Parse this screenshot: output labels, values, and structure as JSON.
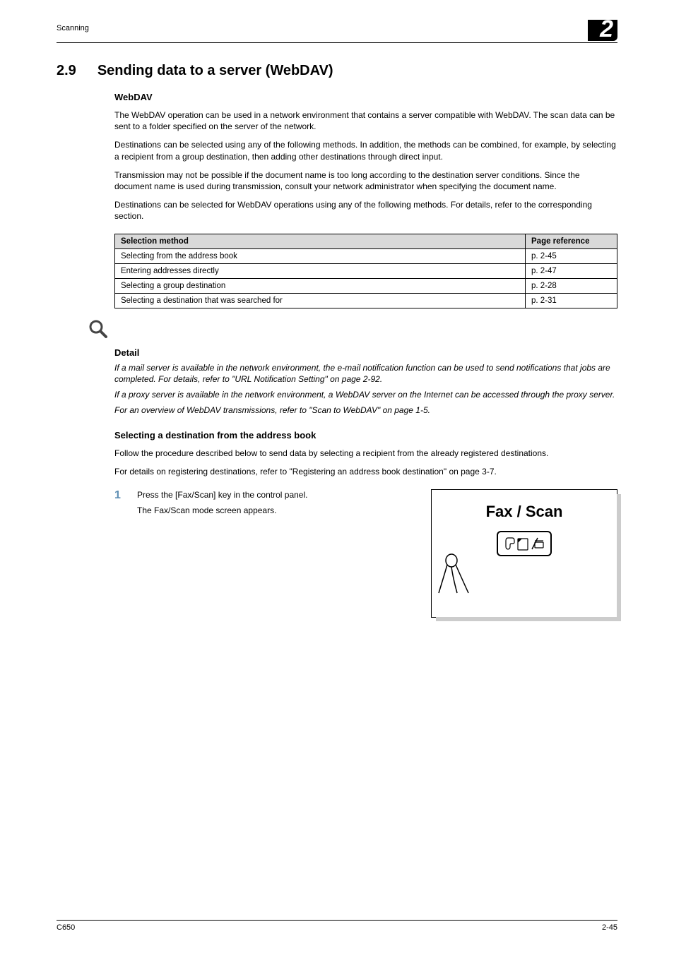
{
  "header": {
    "running_head": "Scanning",
    "chapter_number": "2"
  },
  "section": {
    "number": "2.9",
    "title": "Sending data to a server (WebDAV)"
  },
  "subheading_webdav": "WebDAV",
  "para1": "The WebDAV operation can be used in a network environment that contains a server compatible with WebDAV. The scan data can be sent to a folder specified on the server of the network.",
  "para2": "Destinations can be selected using any of the following methods. In addition, the methods can be combined, for example, by selecting a recipient from a group destination, then adding other destinations through direct input.",
  "para3": "Transmission may not be possible if the document name is too long according to the destination server conditions. Since the document name is used during transmission, consult your network administrator when specifying the document name.",
  "para4": "Destinations can be selected for WebDAV operations using any of the following methods. For details, refer to the corresponding section.",
  "table": {
    "headers": {
      "method": "Selection method",
      "reference": "Page reference"
    },
    "rows": [
      {
        "method": "Selecting from the address book",
        "reference": "p. 2-45"
      },
      {
        "method": "Entering addresses directly",
        "reference": "p. 2-47"
      },
      {
        "method": "Selecting a group destination",
        "reference": "p. 2-28"
      },
      {
        "method": "Selecting a destination that was searched for",
        "reference": "p. 2-31"
      }
    ]
  },
  "detail": {
    "label": "Detail",
    "p1": "If a mail server is available in the network environment, the e-mail notification function can be used to send notifications that jobs are completed. For details, refer to \"URL Notification Setting\" on page 2-92.",
    "p2": "If a proxy server is available in the network environment, a WebDAV server on the Internet can be accessed through the proxy server.",
    "p3": "For an overview of WebDAV transmissions, refer to \"Scan to WebDAV\" on page 1-5."
  },
  "subheading_select": "Selecting a destination from the address book",
  "select_p1": "Follow the procedure described below to send data by selecting a recipient from the already registered destinations.",
  "select_p2": "For details on registering destinations, refer to \"Registering an address book destination\" on page 3-7.",
  "step1": {
    "num": "1",
    "line1": "Press the [Fax/Scan] key in the control panel.",
    "line2": "The Fax/Scan mode screen appears."
  },
  "figure": {
    "title": "Fax / Scan"
  },
  "footer": {
    "left": "C650",
    "right": "2-45"
  }
}
